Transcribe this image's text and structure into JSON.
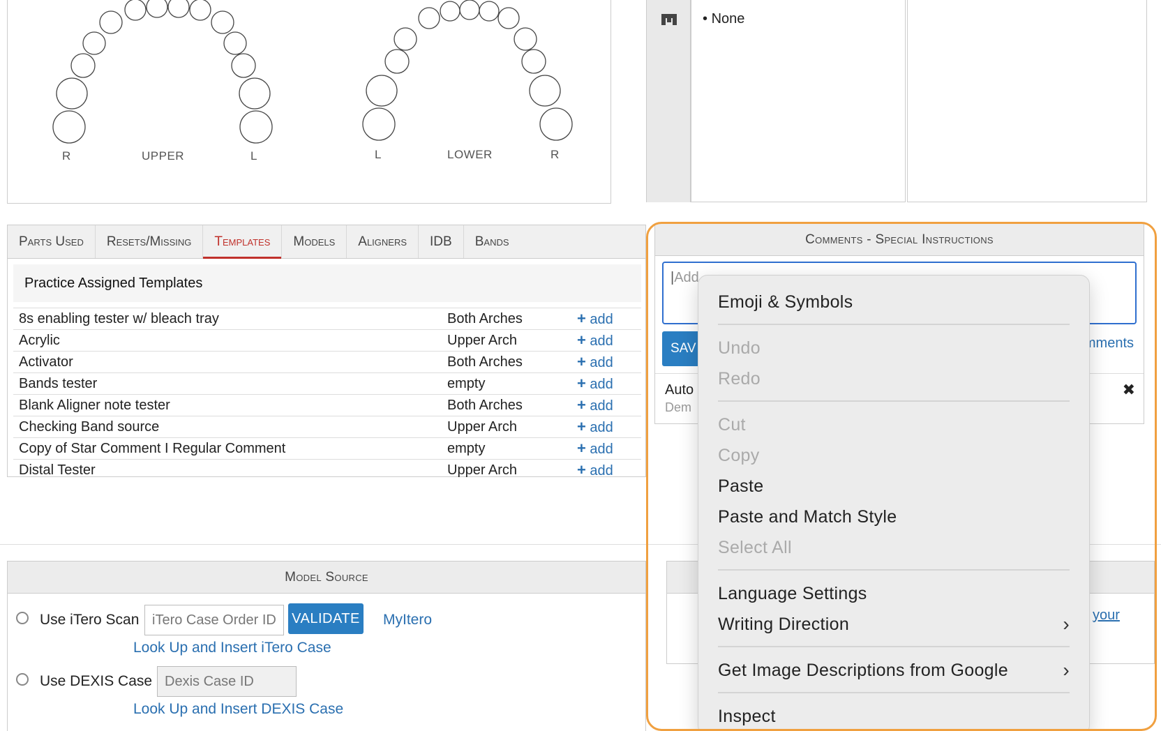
{
  "tooth_chart": {
    "upper": {
      "left_label": "R",
      "center_label": "UPPER",
      "right_label": "L"
    },
    "lower": {
      "left_label": "L",
      "center_label": "LOWER",
      "right_label": "R"
    }
  },
  "lower_box": {
    "items": [
      "None"
    ]
  },
  "tabs": [
    {
      "label": "Parts Used",
      "active": false
    },
    {
      "label": "Resets/Missing",
      "active": false
    },
    {
      "label": "Templates",
      "active": true
    },
    {
      "label": "Models",
      "active": false
    },
    {
      "label": "Aligners",
      "active": false
    },
    {
      "label": "IDB",
      "active": false
    },
    {
      "label": "Bands",
      "active": false
    }
  ],
  "templates": {
    "section_title": "Practice Assigned Templates",
    "add_label": "add",
    "rows": [
      {
        "name": "8s enabling tester w/ bleach tray",
        "arch": "Both Arches"
      },
      {
        "name": "Acrylic",
        "arch": "Upper Arch"
      },
      {
        "name": "Activator",
        "arch": "Both Arches"
      },
      {
        "name": "Bands tester",
        "arch": "empty"
      },
      {
        "name": "Blank Aligner note tester",
        "arch": "Both Arches"
      },
      {
        "name": "Checking Band source",
        "arch": "Upper Arch"
      },
      {
        "name": "Copy of Star Comment I Regular Comment",
        "arch": "empty"
      },
      {
        "name": "Distal Tester",
        "arch": "Upper Arch"
      }
    ]
  },
  "comments": {
    "title": "Comments - Special Instructions",
    "placeholder_visible": "Add",
    "save_label": "SAV",
    "link_right": "mments",
    "item_author": "Auto",
    "item_sub": "Dem",
    "close_glyph": "✖"
  },
  "model_source": {
    "title": "Model Source",
    "itero": {
      "label": "Use iTero Scan",
      "placeholder": "iTero Case Order ID",
      "validate": "VALIDATE",
      "link": "MyItero",
      "lookup": "Look Up and Insert iTero Case"
    },
    "dexis": {
      "label": "Use DEXIS Case",
      "placeholder": "Dexis Case ID",
      "lookup": "Look Up and Insert DEXIS Case"
    }
  },
  "partial_box": {
    "link": "your"
  },
  "context_menu": {
    "groups": [
      [
        {
          "label": "Emoji & Symbols",
          "enabled": true
        }
      ],
      [
        {
          "label": "Undo",
          "enabled": false
        },
        {
          "label": "Redo",
          "enabled": false
        }
      ],
      [
        {
          "label": "Cut",
          "enabled": false
        },
        {
          "label": "Copy",
          "enabled": false
        },
        {
          "label": "Paste",
          "enabled": true
        },
        {
          "label": "Paste and Match Style",
          "enabled": true
        },
        {
          "label": "Select All",
          "enabled": false
        }
      ],
      [
        {
          "label": "Language Settings",
          "enabled": true
        },
        {
          "label": "Writing Direction",
          "enabled": true,
          "submenu": true
        }
      ],
      [
        {
          "label": "Get Image Descriptions from Google",
          "enabled": true,
          "submenu": true
        }
      ],
      [
        {
          "label": "Inspect",
          "enabled": true
        }
      ]
    ]
  },
  "colors": {
    "accent_blue": "#2a7ec2",
    "active_tab": "#c0312b",
    "highlight": "#f0a040"
  }
}
